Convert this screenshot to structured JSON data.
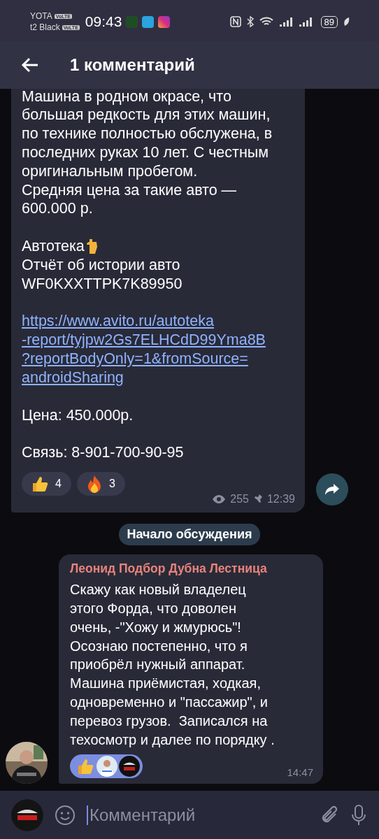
{
  "status_bar": {
    "carriers": [
      {
        "name": "YOTA",
        "badge": "VoLTE"
      },
      {
        "name": "t2 Black",
        "badge": "VoLTE"
      }
    ],
    "time": "09:43",
    "battery": "89"
  },
  "header": {
    "title": "1 комментарий"
  },
  "post": {
    "blocks": [
      {
        "kind": "text",
        "text": "Машина в родном окрасе, что\nбольшая редкость для этих машин,\nпо технике полностью обслужена, в\nпоследних руках 10 лет. С честным\nоригинальным пробегом.\nСредняя цена за такие авто —\n600.000 р."
      },
      {
        "kind": "pointer",
        "text": "Автотека"
      },
      {
        "kind": "text",
        "text": "Отчёт об истории авто\nWF0KXXTTPK7K89950"
      },
      {
        "kind": "link",
        "text": "https://www.avito.ru/autoteka\n-report/tyjpw2Gs7ELHCdD99Yma8B\n?reportBodyOnly=1&fromSource=\nandroidSharing"
      },
      {
        "kind": "text",
        "text": "Цена: 450.000р."
      },
      {
        "kind": "text",
        "text": "Связь: 8-901-700-90-95"
      }
    ],
    "reactions": [
      {
        "kind": "like",
        "count": "4"
      },
      {
        "kind": "fire",
        "count": "3"
      }
    ],
    "views": "255",
    "time": "12:39"
  },
  "service": "Начало обсуждения",
  "comment": {
    "author": "Леонид Подбор Дубна Лестница",
    "text": "Скажу как новый владелец\nэтого Форда, что доволен\nочень, -\"Хожу и жмурюсь\"!\nОсознаю постепенно, что я\nприобрёл нужный аппарат.\nМашина приёмистая, ходкая,\nодновременно и \"пассажир\", и\nперевоз грузов.  Записался на\nтехосмотр и далее по порядку .",
    "reaction": {
      "kind": "like",
      "selected": true
    },
    "time": "14:47"
  },
  "input": {
    "placeholder": "Комментарий"
  }
}
